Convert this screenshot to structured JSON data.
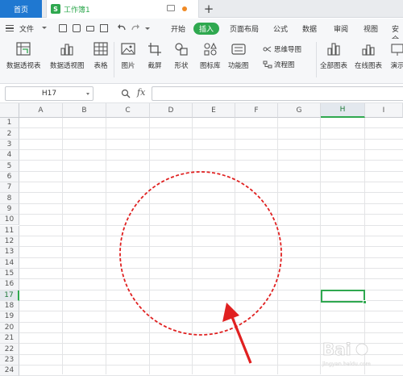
{
  "titlebar": {
    "home_tab": "首页",
    "doc_tab": "工作簿1",
    "doc_logo": "S",
    "new_tab_glyph": "+"
  },
  "menubar": {
    "file_label": "文件",
    "tabs": [
      "开始",
      "插入",
      "页面布局",
      "公式",
      "数据",
      "审阅",
      "视图",
      "安全"
    ],
    "active_tab": "插入"
  },
  "ribbon": {
    "buttons": [
      {
        "label": "数据透视表",
        "icon": "pivot-table-icon"
      },
      {
        "label": "数据透视图",
        "icon": "pivot-chart-icon"
      },
      {
        "label": "表格",
        "icon": "table-icon"
      },
      {
        "label": "图片",
        "icon": "picture-icon"
      },
      {
        "label": "截屏",
        "icon": "screenshot-icon"
      },
      {
        "label": "形状",
        "icon": "shapes-icon"
      },
      {
        "label": "图标库",
        "icon": "icon-library-icon"
      },
      {
        "label": "功能图",
        "icon": "function-chart-icon"
      },
      {
        "label": "全部图表",
        "icon": "all-charts-icon"
      },
      {
        "label": "在线图表",
        "icon": "online-charts-icon"
      },
      {
        "label": "演示",
        "icon": "presentation-icon"
      }
    ],
    "small_buttons": [
      {
        "label": "思维导图",
        "icon": "mindmap-icon"
      },
      {
        "label": "流程图",
        "icon": "flowchart-icon"
      }
    ]
  },
  "formula_bar": {
    "name_box": "H17",
    "fx_label": "fx",
    "formula": ""
  },
  "sheet": {
    "columns": [
      "A",
      "B",
      "C",
      "D",
      "E",
      "F",
      "G",
      "H",
      "I"
    ],
    "selected_column": "H",
    "rows": [
      "1",
      "2",
      "3",
      "4",
      "5",
      "6",
      "7",
      "8",
      "9",
      "10",
      "11",
      "12",
      "13",
      "14",
      "15",
      "16",
      "17",
      "18",
      "19",
      "20",
      "21",
      "22",
      "23",
      "24"
    ],
    "selected_row": "17"
  },
  "annotation": {
    "circle_color": "#e02020",
    "arrow_color": "#e02020"
  },
  "watermark": {
    "brand": "Bai",
    "sub": "jingyan.baidu.com"
  },
  "colors": {
    "accent_green": "#2fa84f",
    "home_blue": "#1f78d1"
  }
}
